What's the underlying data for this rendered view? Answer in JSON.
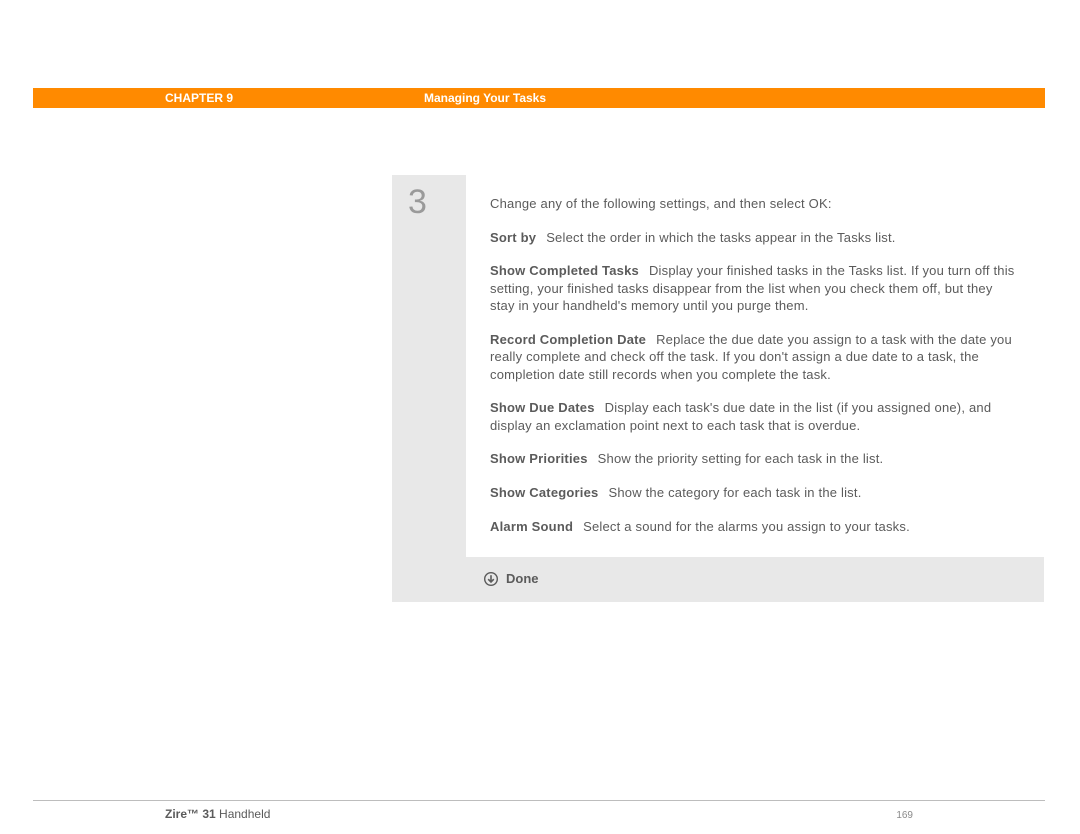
{
  "header": {
    "chapter": "CHAPTER 9",
    "title": "Managing Your Tasks"
  },
  "step": {
    "number": "3",
    "intro": "Change any of the following settings, and then select OK:",
    "settings": [
      {
        "label": "Sort by",
        "desc": "Select the order in which the tasks appear in the Tasks list."
      },
      {
        "label": "Show Completed Tasks",
        "desc": "Display your finished tasks in the Tasks list. If you turn off this setting, your finished tasks disappear from the list when you check them off, but they stay in your handheld's memory until you purge them."
      },
      {
        "label": "Record Completion Date",
        "desc": "Replace the due date you assign to a task with the date you really complete and check off the task. If you don't assign a due date to a task, the completion date still records when you complete the task."
      },
      {
        "label": "Show Due Dates",
        "desc": "Display each task's due date in the list (if you assigned one), and display an exclamation point next to each task that is overdue."
      },
      {
        "label": "Show Priorities",
        "desc": "Show the priority setting for each task in the list."
      },
      {
        "label": "Show Categories",
        "desc": "Show the category for each task in the list."
      },
      {
        "label": "Alarm Sound",
        "desc": "Select a sound for the alarms you assign to your tasks."
      }
    ],
    "done": "Done"
  },
  "footer": {
    "product_bold": "Zire™ 31",
    "product_rest": " Handheld",
    "page": "169"
  }
}
